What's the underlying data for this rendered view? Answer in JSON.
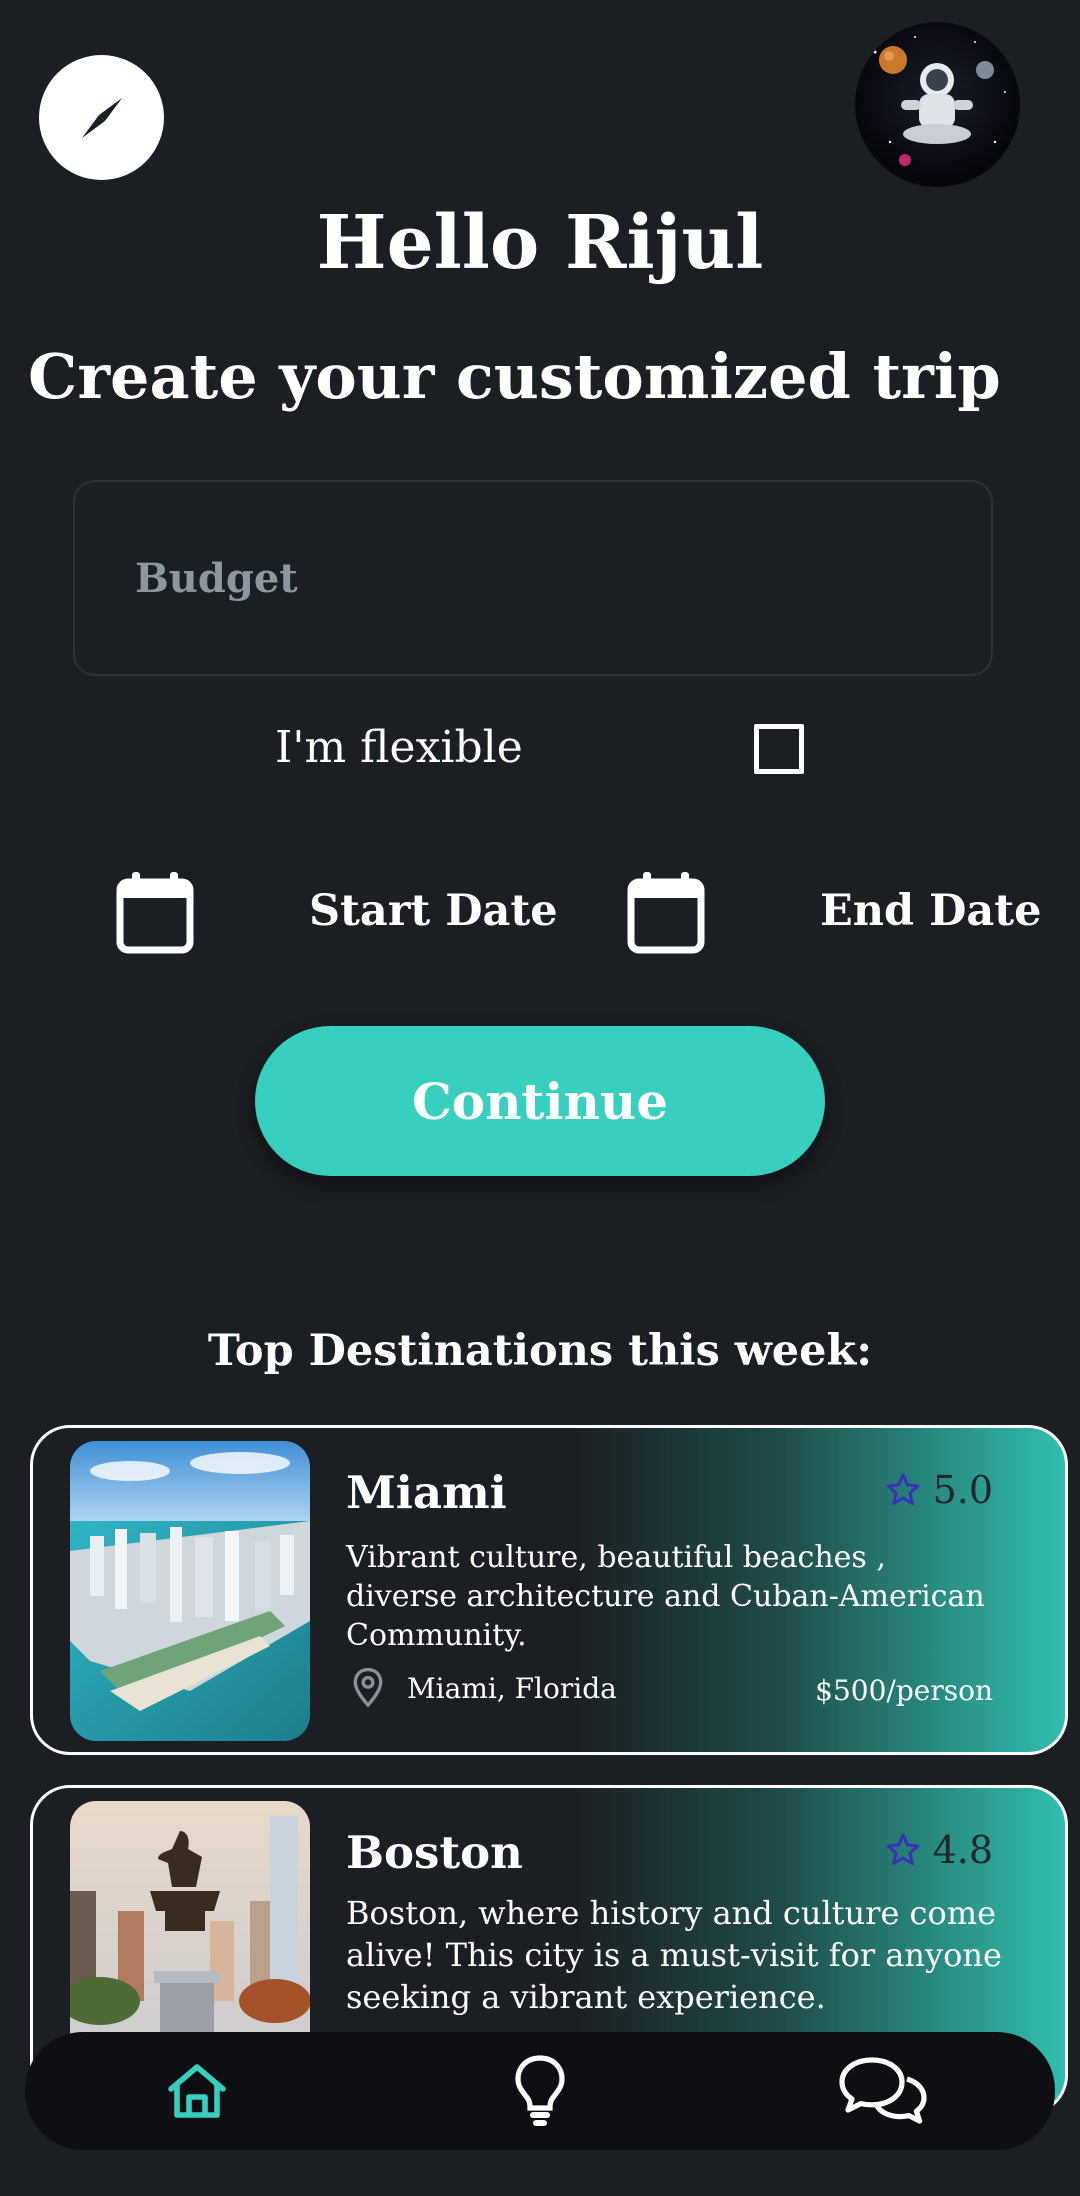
{
  "header": {
    "compass_icon": "compass-icon",
    "avatar_icon": "astronaut-avatar",
    "greeting": "Hello Rijul"
  },
  "form": {
    "title": "Create your customized trip",
    "budget_placeholder": "Budget",
    "budget_value": "",
    "flexible_label": "I'm flexible",
    "flexible_checked": false,
    "start_date_label": "Start Date",
    "end_date_label": "End Date",
    "continue_label": "Continue"
  },
  "destinations": {
    "title": "Top Destinations this week:",
    "items": [
      {
        "name": "Miami",
        "rating": "5.0",
        "description": "Vibrant culture, beautiful beaches , diverse architecture and Cuban-American Community.",
        "location": "Miami, Florida",
        "price": "$500/person"
      },
      {
        "name": "Boston",
        "rating": "4.8",
        "description": "Boston, where history and culture come alive! This city is a must-visit for anyone seeking a vibrant experience."
      }
    ]
  },
  "bottom_nav": {
    "items": [
      "home-icon",
      "lightbulb-icon",
      "chat-icon"
    ],
    "active": "home-icon"
  },
  "colors": {
    "background": "#1b1e22",
    "accent": "#37cfbd",
    "star": "#3a2fb8",
    "nav_background": "#0d0f12"
  }
}
